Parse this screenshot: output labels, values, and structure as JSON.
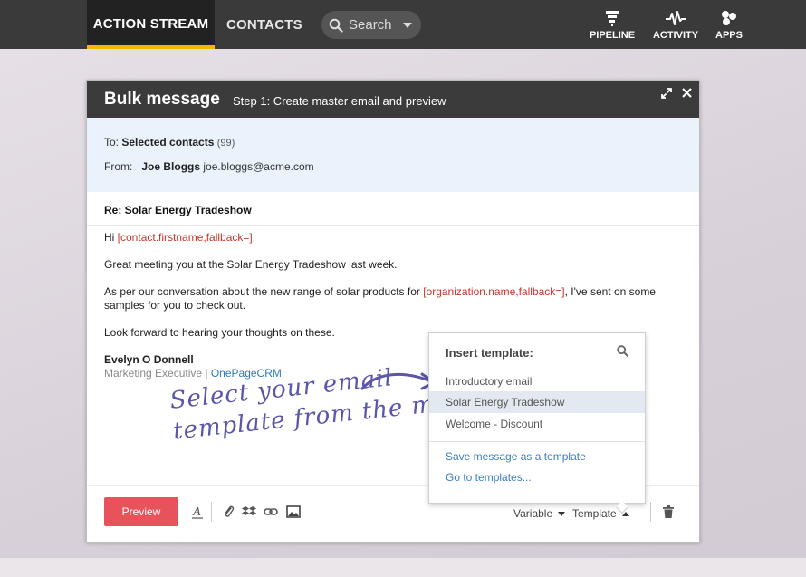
{
  "nav": {
    "action_stream": "ACTION STREAM",
    "contacts": "CONTACTS",
    "search_placeholder": "Search",
    "pipeline": "PIPELINE",
    "activity": "ACTIVITY",
    "apps": "APPS"
  },
  "modal": {
    "title": "Bulk message",
    "step": "Step 1: Create master email and preview",
    "to_label": "To:",
    "to_value": "Selected contacts",
    "to_count": "(99)",
    "from_label": "From:",
    "from_name": "Joe Bloggs",
    "from_email": "joe.bloggs@acme.com",
    "subject": "Re: Solar Energy Tradeshow",
    "body": {
      "greeting_prefix": "Hi ",
      "greeting_merge": "[contact.firstname,fallback=]",
      "greeting_suffix": ",",
      "line1": "Great meeting you at the Solar Energy Tradeshow last week.",
      "line2_prefix": "As per our conversation about the new range of solar products for ",
      "line2_merge": "[organization.name,fallback=]",
      "line2_suffix": ", I've sent on some samples for you to check out.",
      "line3": "Look forward to hearing your thoughts on these.",
      "sig_name": "Evelyn O Donnell",
      "sig_role": "Marketing Executive",
      "sig_divider": " | ",
      "sig_company": "OnePageCRM"
    },
    "annotation": {
      "line1": "Select your email",
      "line2": "template from the menu."
    },
    "toolbar": {
      "preview": "Preview",
      "variable": "Variable",
      "template": "Template"
    }
  },
  "template_menu": {
    "heading": "Insert template:",
    "items": [
      {
        "label": "Introductory email",
        "selected": false
      },
      {
        "label": "Solar Energy Tradeshow",
        "selected": true
      },
      {
        "label": "Welcome - Discount",
        "selected": false
      }
    ],
    "save_link": "Save message as a template",
    "goto_link": "Go to templates..."
  },
  "colors": {
    "accent_tab": "#f5b800",
    "preview_button": "#e8525a",
    "merge_field": "#c0392b",
    "link": "#2b7bbd",
    "handwriting": "#5a56a8"
  },
  "icons": {
    "search": "search-icon",
    "pipeline": "pipeline-icon",
    "activity": "activity-icon",
    "apps": "apps-icon",
    "expand": "expand-icon",
    "close": "close-icon",
    "text_format": "text-format-icon",
    "attachment": "paperclip-icon",
    "dropbox": "dropbox-icon",
    "link": "link-icon",
    "image": "image-icon",
    "delete": "trash-icon"
  }
}
